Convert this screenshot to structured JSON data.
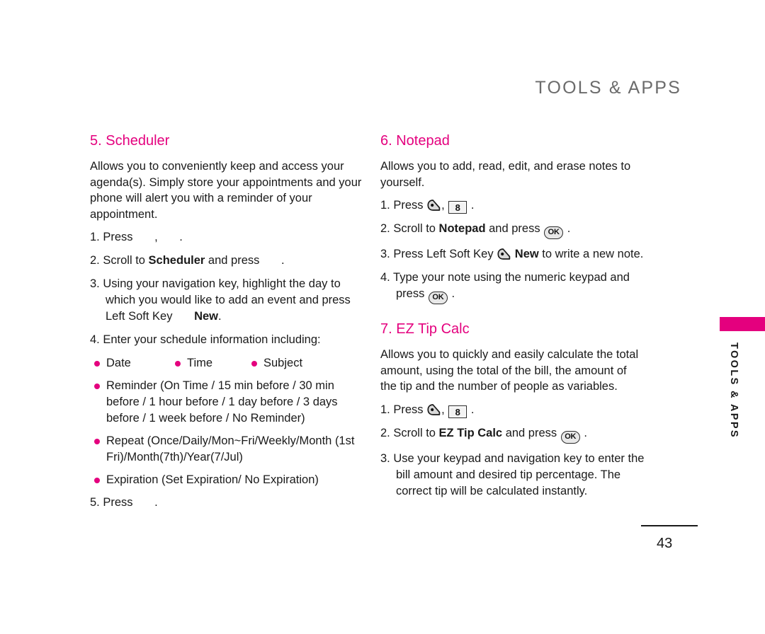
{
  "header": {
    "title": "TOOLS & APPS"
  },
  "side_tab": {
    "label": "TOOLS & APPS",
    "bar_color": "#e4007e"
  },
  "footer": {
    "page_number": "43"
  },
  "theme": {
    "accent": "#e4007e",
    "header_gray": "#6b6b6b",
    "body_text": "#1a1a1a"
  },
  "icons": {
    "softkey": "left-soft-key-icon",
    "key8": "8",
    "ok": "OK"
  },
  "left_column": {
    "section": {
      "title": "5. Scheduler",
      "intro": "Allows you to conveniently keep and access your agenda(s). Simply store your appointments and your phone will alert you with a reminder of your appointment.",
      "steps": [
        {
          "num": "1.",
          "parts": [
            {
              "type": "text",
              "value": "Press "
            },
            {
              "type": "gap"
            },
            {
              "type": "text",
              "value": ", "
            },
            {
              "type": "gap"
            },
            {
              "type": "text",
              "value": "."
            }
          ]
        },
        {
          "num": "2.",
          "parts": [
            {
              "type": "text",
              "value": "Scroll to "
            },
            {
              "type": "bold",
              "value": "Scheduler"
            },
            {
              "type": "text",
              "value": " and press "
            },
            {
              "type": "gap"
            },
            {
              "type": "text",
              "value": "."
            }
          ]
        },
        {
          "num": "3.",
          "parts": [
            {
              "type": "text",
              "value": "Using your navigation key, highlight the day to which you would like to add an event and press Left Soft Key "
            },
            {
              "type": "gap"
            },
            {
              "type": "bold",
              "value": "New"
            },
            {
              "type": "text",
              "value": "."
            }
          ]
        },
        {
          "num": "4.",
          "parts": [
            {
              "type": "text",
              "value": "Enter your schedule information including:"
            }
          ]
        }
      ],
      "bullet_row": [
        "Date",
        "Time",
        "Subject"
      ],
      "bullets": [
        "Reminder (On Time / 15 min before / 30 min before / 1 hour before / 1 day before / 3 days before / 1 week before / No Reminder)",
        "Repeat (Once/Daily/Mon~Fri/Weekly/Month (1st Fri)/Month(7th)/Year(7/Jul)",
        "Expiration (Set Expiration/ No Expiration)"
      ],
      "final_step": {
        "num": "5.",
        "parts": [
          {
            "type": "text",
            "value": "Press "
          },
          {
            "type": "gap"
          },
          {
            "type": "text",
            "value": "."
          }
        ]
      }
    }
  },
  "right_column": {
    "sections": [
      {
        "title": "6. Notepad",
        "intro": "Allows you to add, read, edit, and erase notes to yourself.",
        "steps": [
          {
            "num": "1.",
            "parts": [
              {
                "type": "text",
                "value": "Press "
              },
              {
                "type": "softkey"
              },
              {
                "type": "text",
                "value": ", "
              },
              {
                "type": "numkey",
                "value": "8"
              },
              {
                "type": "text",
                "value": " ."
              }
            ]
          },
          {
            "num": "2.",
            "parts": [
              {
                "type": "text",
                "value": "Scroll to "
              },
              {
                "type": "bold",
                "value": "Notepad"
              },
              {
                "type": "text",
                "value": " and press "
              },
              {
                "type": "okkey",
                "value": "OK"
              },
              {
                "type": "text",
                "value": " ."
              }
            ]
          },
          {
            "num": "3.",
            "parts": [
              {
                "type": "text",
                "value": "Press Left Soft Key "
              },
              {
                "type": "softkey"
              },
              {
                "type": "bold",
                "value": " New"
              },
              {
                "type": "text",
                "value": " to write a new note."
              }
            ]
          },
          {
            "num": "4.",
            "parts": [
              {
                "type": "text",
                "value": "Type your note using the numeric keypad and press "
              },
              {
                "type": "okkey",
                "value": "OK"
              },
              {
                "type": "text",
                "value": " ."
              }
            ]
          }
        ]
      },
      {
        "title": "7. EZ Tip Calc",
        "intro": "Allows you to quickly and easily calculate the total amount, using the total of the bill, the amount of the tip and the number of people as variables.",
        "steps": [
          {
            "num": "1.",
            "parts": [
              {
                "type": "text",
                "value": "Press "
              },
              {
                "type": "softkey"
              },
              {
                "type": "text",
                "value": ", "
              },
              {
                "type": "numkey",
                "value": "8"
              },
              {
                "type": "text",
                "value": " ."
              }
            ]
          },
          {
            "num": "2.",
            "parts": [
              {
                "type": "text",
                "value": "Scroll to "
              },
              {
                "type": "bold",
                "value": "EZ Tip Calc"
              },
              {
                "type": "text",
                "value": " and press "
              },
              {
                "type": "okkey",
                "value": "OK"
              },
              {
                "type": "text",
                "value": " ."
              }
            ]
          },
          {
            "num": "3.",
            "parts": [
              {
                "type": "text",
                "value": "Use your keypad and navigation key to enter the bill amount and desired tip percentage. The correct tip will be calculated instantly."
              }
            ]
          }
        ]
      }
    ]
  }
}
